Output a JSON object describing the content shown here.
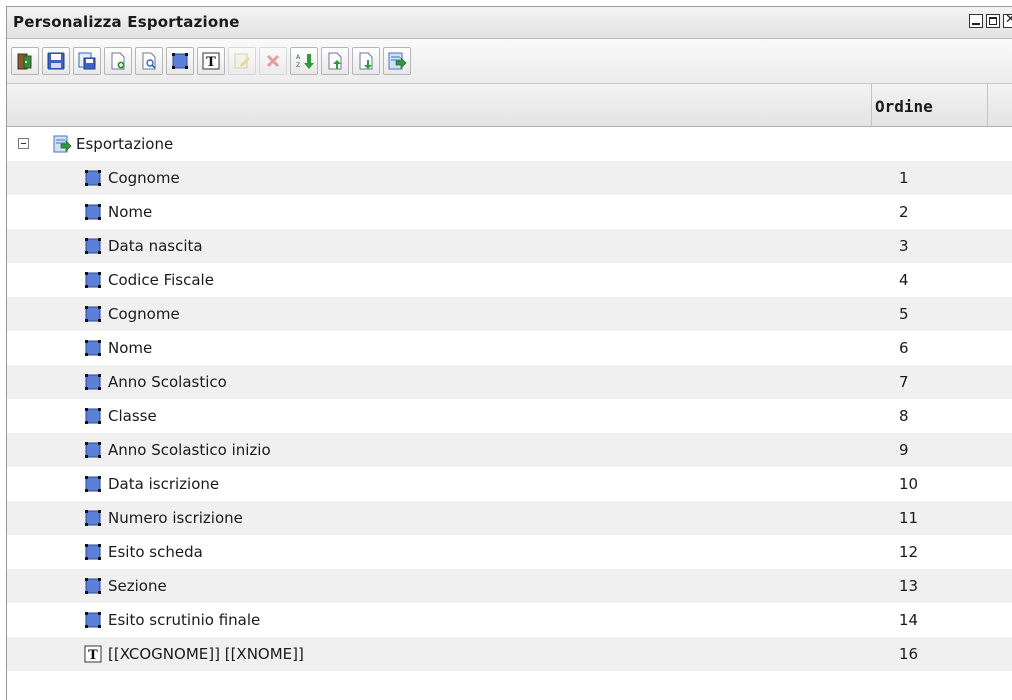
{
  "window": {
    "title": "Personalizza Esportazione"
  },
  "toolbar": {
    "buttons": [
      {
        "icon": "exit-door-icon",
        "enabled": true
      },
      {
        "icon": "save-icon",
        "enabled": true
      },
      {
        "icon": "save-as-icon",
        "enabled": true
      },
      {
        "icon": "new-document-icon",
        "enabled": true
      },
      {
        "icon": "preview-document-icon",
        "enabled": true
      },
      {
        "icon": "field-icon",
        "enabled": true
      },
      {
        "icon": "text-icon",
        "enabled": true
      },
      {
        "icon": "edit-icon",
        "enabled": false
      },
      {
        "icon": "delete-icon",
        "enabled": false
      },
      {
        "icon": "sort-icon",
        "enabled": true
      },
      {
        "icon": "move-up-icon",
        "enabled": true
      },
      {
        "icon": "move-down-icon",
        "enabled": true
      },
      {
        "icon": "export-icon",
        "enabled": true
      }
    ]
  },
  "columns": {
    "ordine": "Ordine"
  },
  "tree": {
    "root": "Esportazione",
    "items": [
      {
        "label": "Cognome",
        "order": "1",
        "icon": "field-icon"
      },
      {
        "label": "Nome",
        "order": "2",
        "icon": "field-icon"
      },
      {
        "label": "Data nascita",
        "order": "3",
        "icon": "field-icon"
      },
      {
        "label": "Codice Fiscale",
        "order": "4",
        "icon": "field-icon"
      },
      {
        "label": "Cognome",
        "order": "5",
        "icon": "field-icon"
      },
      {
        "label": "Nome",
        "order": "6",
        "icon": "field-icon"
      },
      {
        "label": "Anno Scolastico",
        "order": "7",
        "icon": "field-icon"
      },
      {
        "label": "Classe",
        "order": "8",
        "icon": "field-icon"
      },
      {
        "label": "Anno Scolastico inizio",
        "order": "9",
        "icon": "field-icon"
      },
      {
        "label": "Data iscrizione",
        "order": "10",
        "icon": "field-icon"
      },
      {
        "label": "Numero iscrizione",
        "order": "11",
        "icon": "field-icon"
      },
      {
        "label": "Esito scheda",
        "order": "12",
        "icon": "field-icon"
      },
      {
        "label": "Sezione",
        "order": "13",
        "icon": "field-icon"
      },
      {
        "label": "Esito scrutinio finale",
        "order": "14",
        "icon": "field-icon"
      },
      {
        "label": "[[XCOGNOME]] [[XNOME]]",
        "order": "16",
        "icon": "text-icon"
      }
    ]
  },
  "colors": {
    "row_alt": "#f0f0f0",
    "field_icon": "#3a63c6",
    "export_icon": "#2f9a3a"
  }
}
